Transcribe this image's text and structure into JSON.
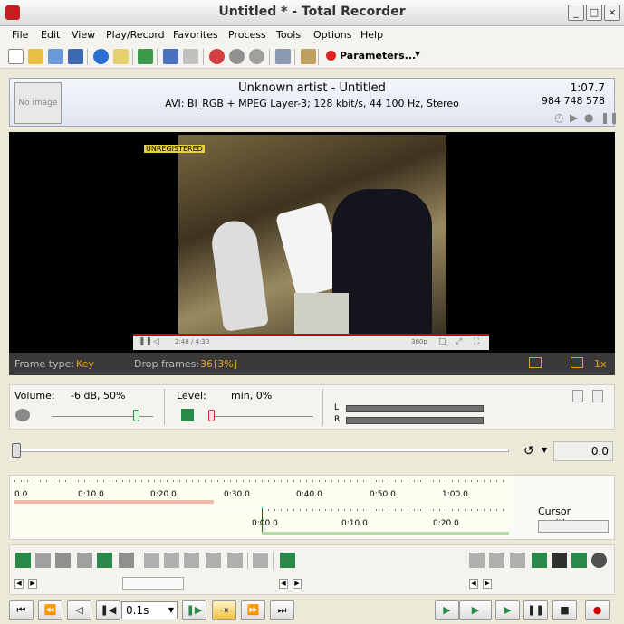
{
  "window": {
    "title": "Untitled * - Total Recorder"
  },
  "menu": [
    "File",
    "Edit",
    "View",
    "Play/Record",
    "Favorites",
    "Process",
    "Tools",
    "Options",
    "Help"
  ],
  "toolbar": {
    "parameters_label": "Parameters..."
  },
  "info": {
    "no_image": "No image",
    "title": "Unknown artist - Untitled",
    "description": "AVI: BI_RGB + MPEG Layer-3; 128 kbit/s, 44 100 Hz, Stereo",
    "duration": "1:07.7",
    "size": "984 748 578"
  },
  "video": {
    "watermark": "UNREGISTERED",
    "player_time": "2:48 / 4:30",
    "player_quality": "360p"
  },
  "video_status": {
    "frame_type_label": "Frame type:",
    "frame_type_value": "Key",
    "drop_frames_label": "Drop frames:",
    "drop_frames_value": "36",
    "drop_frames_pct": "[3%]",
    "speed": "1x"
  },
  "mixer": {
    "volume_label": "Volume:",
    "volume_value": "-6 dB, 50%",
    "level_label": "Level:",
    "level_value": "min, 0%",
    "channel_l": "L",
    "channel_r": "R"
  },
  "position": {
    "value": "0.0"
  },
  "timeline": {
    "ticks_top": [
      "0.0",
      "0:10.0",
      "0:20.0",
      "0:30.0",
      "0:40.0",
      "0:50.0",
      "1:00.0"
    ],
    "ticks_bottom": [
      "0:00.0",
      "0:10.0",
      "0:20.0"
    ],
    "cursor_label": "Cursor position:"
  },
  "transport": {
    "speed": "0.1s"
  }
}
